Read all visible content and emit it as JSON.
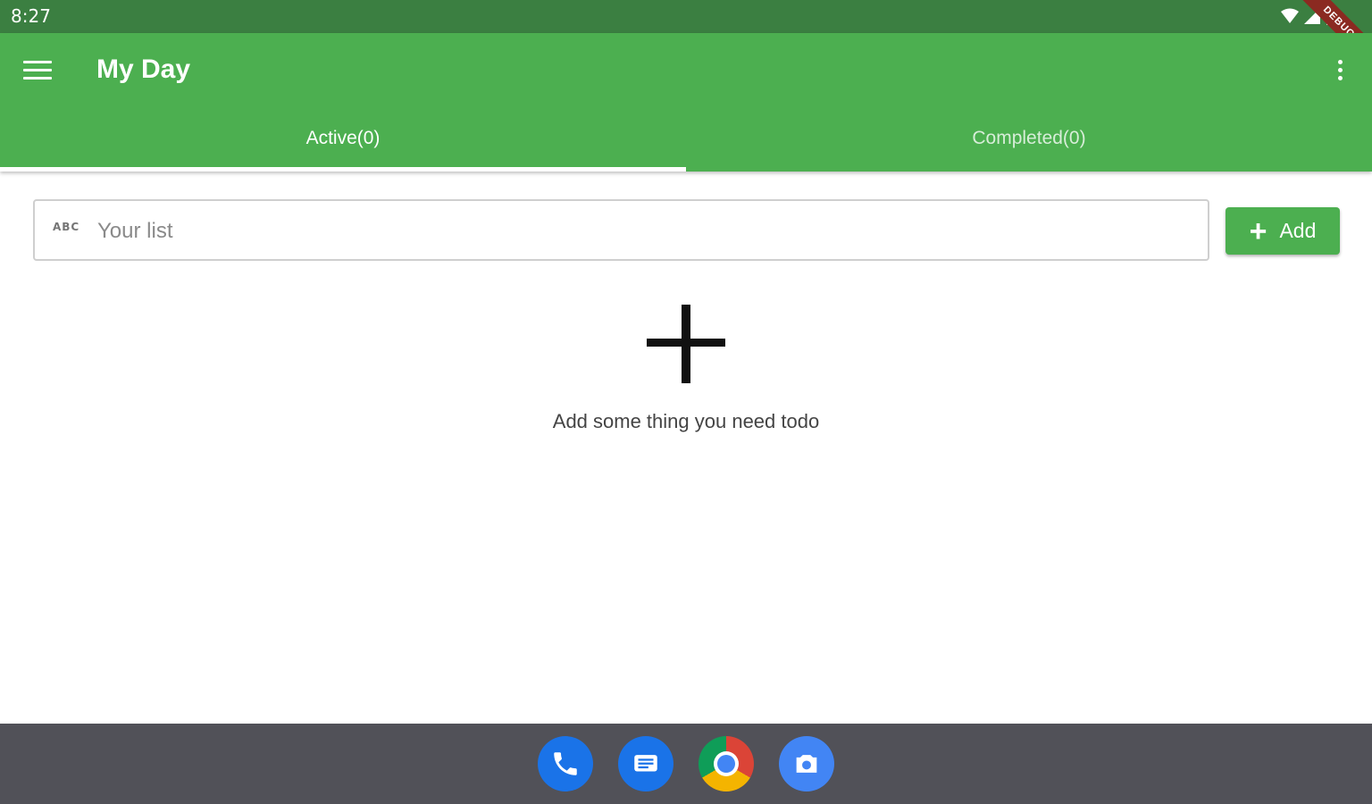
{
  "status_bar": {
    "time": "8:27",
    "debug_label": "DEBUG"
  },
  "app_bar": {
    "title": "My Day"
  },
  "tabs": [
    {
      "label": "Active(0)",
      "selected": true
    },
    {
      "label": "Completed(0)",
      "selected": false
    }
  ],
  "input": {
    "icon_label": "ABC",
    "placeholder": "Your list",
    "value": ""
  },
  "add_button": {
    "icon": "+",
    "label": "Add"
  },
  "empty_state": {
    "icon": "plus-icon",
    "message": "Add some thing you need todo"
  },
  "dock": [
    "phone",
    "messages",
    "chrome",
    "camera"
  ],
  "colors": {
    "primary": "#4caf50",
    "status_bar": "#3b7f41",
    "nav_bar": "#515158"
  }
}
